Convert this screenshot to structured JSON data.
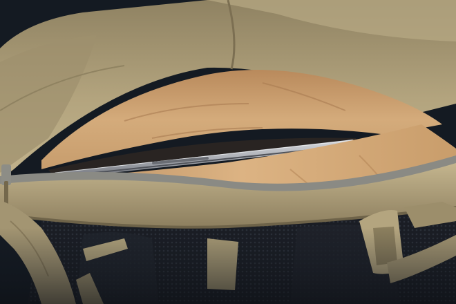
{
  "photo": {
    "subject": "",
    "palette": {
      "background_dark": "#141a22",
      "fabric_khaki": "#a99a74",
      "fabric_khaki_dark": "#7f7254",
      "fabric_khaki_light": "#c3b48f",
      "lining_tan": "#d2a877",
      "lining_tan_dark": "#a97f56",
      "laptop_silver": "#b9bcc2",
      "laptop_edge_dark": "#5e6168",
      "zipper_grey": "#8a8a84",
      "mesh_black": "#1c1f26",
      "strap_khaki": "#b1a37c"
    }
  }
}
